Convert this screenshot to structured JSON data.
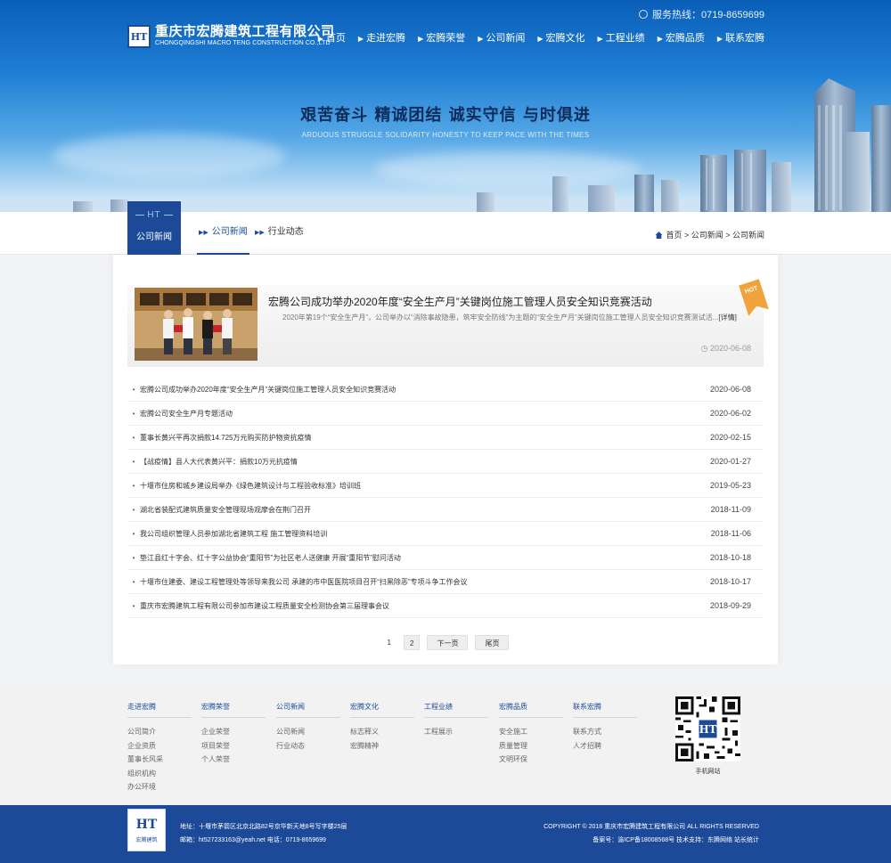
{
  "header": {
    "hotline": "服务热线：0719-8659699",
    "company_name": "重庆市宏腾建筑工程有限公司",
    "company_name_en": "CHONGQINGSHI MACRO TENG CONSTRUCTION CO.,LTD",
    "logo_mark": "HT",
    "nav": [
      "首页",
      "走进宏腾",
      "宏腾荣誉",
      "公司新闻",
      "宏腾文化",
      "工程业绩",
      "宏腾品质",
      "联系宏腾"
    ],
    "slogan": "艰苦奋斗  精诚团结    诚实守信  与时俱进",
    "slogan_en": "ARDUOUS STRUGGLE SOLIDARITY HONESTY TO KEEP PACE WITH THE TIMES"
  },
  "subnav": {
    "section_code": "HT",
    "section_name": "公司新闻",
    "tabs": [
      "公司新闻",
      "行业动态"
    ],
    "breadcrumb": "首页 > 公司新闻 > 公司新闻"
  },
  "featured": {
    "badge": "HOT",
    "title": "宏腾公司成功举办2020年度“安全生产月”关键岗位施工管理人员安全知识竞赛活动",
    "summary": "2020年第19个“安全生产月”，公司举办以“消除事故隐患，筑牢安全防线”为主题的“安全生产月”关键岗位施工管理人员安全知识竞赛测试活...",
    "more": "[详情]",
    "date": "2020-06-08"
  },
  "news": [
    {
      "title": "宏腾公司成功举办2020年度“安全生产月”关键岗位施工管理人员安全知识竞赛活动",
      "date": "2020-06-08"
    },
    {
      "title": "宏腾公司安全生产月专题活动",
      "date": "2020-06-02"
    },
    {
      "title": "董事长黄兴平再次捐款14.725万元购买防护物资抗疫情",
      "date": "2020-02-15"
    },
    {
      "title": "【战疫情】县人大代表黄兴平：捐款10万元抗疫情",
      "date": "2020-01-27"
    },
    {
      "title": "十堰市住房和城乡建设局举办《绿色建筑设计与工程验收标准》培训班",
      "date": "2019-05-23"
    },
    {
      "title": "湖北省装配式建筑质量安全管理现场观摩会在荆门召开",
      "date": "2018-11-09"
    },
    {
      "title": "我公司组织管理人员参加湖北省建筑工程 施工管理资料培训",
      "date": "2018-11-06"
    },
    {
      "title": "垫江县红十字会、红十字公益协会“重阳节”为社区老人送健康  开展“重阳节”慰问活动",
      "date": "2018-10-18"
    },
    {
      "title": "十堰市住建委、建设工程管理处等领导来我公司 承建的市中医医院项目召开“扫黑除恶”专项斗争工作会议",
      "date": "2018-10-17"
    },
    {
      "title": "重庆市宏腾建筑工程有限公司参加市建设工程质量安全检测协会第三届理事会议",
      "date": "2018-09-29"
    }
  ],
  "pager": {
    "p1": "1",
    "p2": "2",
    "next": "下一页",
    "last": "尾页"
  },
  "footer": {
    "columns": [
      {
        "title": "走进宏腾",
        "links": [
          "公司简介",
          "企业资质",
          "董事长风采",
          "组织机构",
          "办公环境"
        ]
      },
      {
        "title": "宏腾荣誉",
        "links": [
          "企业荣誉",
          "项目荣誉",
          "个人荣誉"
        ]
      },
      {
        "title": "公司新闻",
        "links": [
          "公司新闻",
          "行业动态"
        ]
      },
      {
        "title": "宏腾文化",
        "links": [
          "标志释义",
          "宏腾精神"
        ]
      },
      {
        "title": "工程业绩",
        "links": [
          "工程展示"
        ]
      },
      {
        "title": "宏腾品质",
        "links": [
          "安全施工",
          "质量管理",
          "文明环保"
        ]
      },
      {
        "title": "联系宏腾",
        "links": [
          "联系方式",
          "人才招聘"
        ]
      }
    ],
    "qr_label": "手机网站",
    "logo_text": "宏腾建筑",
    "address": "地址：十堰市茅箭区北京北路82号京华新天地8号写字楼25层",
    "contact": "邮箱：ht527233163@yeah.net 电话：0719-8659699",
    "copyright": "COPYRIGHT © 2018 重庆市宏腾建筑工程有限公司 ALL RIGHTS RESERVED",
    "icp": "备案号：渝ICP备18008568号 技术支持：东腾网络 站长统计"
  }
}
